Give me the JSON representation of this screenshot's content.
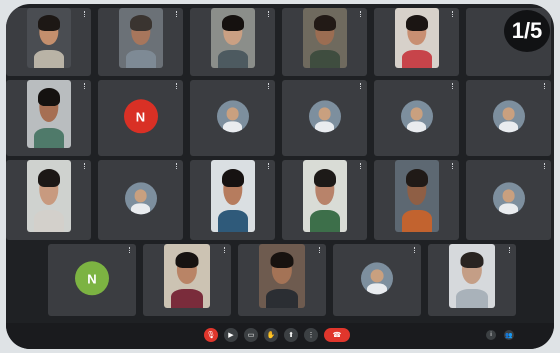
{
  "page_counter": "1/5",
  "rows": [
    [
      {
        "type": "video",
        "name": "",
        "skin": "#c48f6d",
        "hair": "#1d1815",
        "shirt": "#b9b3a6",
        "bg": "#4a4d52"
      },
      {
        "type": "video",
        "name": "",
        "skin": "#a7765c",
        "hair": "#3a3430",
        "shirt": "#7e8a95",
        "bg": "#6b7177"
      },
      {
        "type": "video",
        "name": "",
        "skin": "#caa083",
        "hair": "#15110f",
        "shirt": "#4d5a60",
        "bg": "#8b8e8a"
      },
      {
        "type": "video",
        "name": "",
        "skin": "#9b6d52",
        "hair": "#221a16",
        "shirt": "#3f4d3f",
        "bg": "#6f6a5e"
      },
      {
        "type": "video",
        "name": "",
        "skin": "#c88f72",
        "hair": "#1b1513",
        "shirt": "#c7444a",
        "bg": "#d7d1ca"
      },
      {
        "type": "blank",
        "name": ""
      }
    ],
    [
      {
        "type": "video",
        "name": "",
        "skin": "#a66f53",
        "hair": "#151210",
        "shirt": "#4f7a6a",
        "bg": "#b9bdbf"
      },
      {
        "type": "avatar",
        "name": "",
        "letter": "N",
        "color": "#d93025"
      },
      {
        "type": "photo-avatar",
        "name": ""
      },
      {
        "type": "photo-avatar",
        "name": ""
      },
      {
        "type": "photo-avatar",
        "name": ""
      },
      {
        "type": "photo-avatar",
        "name": ""
      }
    ],
    [
      {
        "type": "video",
        "name": "",
        "skin": "#c89a7f",
        "hair": "#1c1816",
        "shirt": "#d3d0cb",
        "bg": "#cfd2cf"
      },
      {
        "type": "photo-avatar",
        "name": ""
      },
      {
        "type": "video",
        "name": "",
        "skin": "#b67c5e",
        "hair": "#161211",
        "shirt": "#2f5a7a",
        "bg": "#dadfe2"
      },
      {
        "type": "video",
        "name": "",
        "skin": "#b8836a",
        "hair": "#1d1a18",
        "shirt": "#3d6f4a",
        "bg": "#d9dcd6"
      },
      {
        "type": "video",
        "name": "",
        "skin": "#8f5f45",
        "hair": "#201a17",
        "shirt": "#c2632f",
        "bg": "#5d6872"
      },
      {
        "type": "photo-avatar",
        "name": ""
      }
    ],
    [
      {
        "type": "avatar",
        "name": "",
        "letter": "N",
        "color": "#7cb342"
      },
      {
        "type": "video",
        "name": "",
        "skin": "#b98466",
        "hair": "#171311",
        "shirt": "#7a2c3b",
        "bg": "#ccc3b3"
      },
      {
        "type": "video",
        "name": "",
        "skin": "#a47356",
        "hair": "#17120f",
        "shirt": "#2b2e33",
        "bg": "#6e5b4f"
      },
      {
        "type": "photo-avatar",
        "name": ""
      },
      {
        "type": "video",
        "name": "",
        "skin": "#c49e86",
        "hair": "#292421",
        "shirt": "#a9b2ba",
        "bg": "#d6d9dc"
      }
    ]
  ],
  "toolbar": {
    "meeting_time": "",
    "controls": [
      {
        "icon": "mic-off-icon",
        "glyph": "🎙",
        "red": true
      },
      {
        "icon": "camera-off-icon",
        "glyph": "▶",
        "red": false
      },
      {
        "icon": "captions-icon",
        "glyph": "▭",
        "red": false
      },
      {
        "icon": "raise-hand-icon",
        "glyph": "✋",
        "red": false
      },
      {
        "icon": "present-icon",
        "glyph": "⬆",
        "red": false
      },
      {
        "icon": "more-options-icon",
        "glyph": "⋮",
        "red": false
      },
      {
        "icon": "end-call-icon",
        "glyph": "☎",
        "red": true,
        "end": true
      }
    ],
    "right_icons": [
      {
        "icon": "info-icon",
        "glyph": "i"
      },
      {
        "icon": "people-icon",
        "glyph": "👥"
      }
    ]
  }
}
